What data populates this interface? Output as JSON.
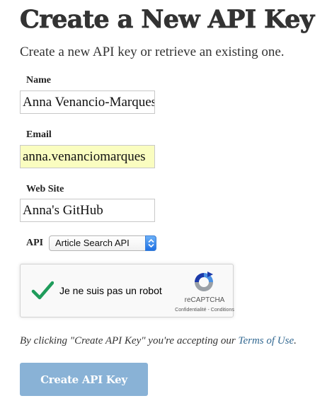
{
  "page": {
    "title": "Create a New API Key",
    "subtitle": "Create a new API key or retrieve an existing one."
  },
  "form": {
    "name": {
      "label": "Name",
      "value": "Anna Venancio-Marques"
    },
    "email": {
      "label": "Email",
      "value": "anna.venanciomarques"
    },
    "website": {
      "label": "Web Site",
      "value": "Anna's GitHub"
    },
    "api": {
      "label": "API",
      "selected": "Article Search API"
    }
  },
  "captcha": {
    "label": "Je ne suis pas un robot",
    "checked": true,
    "brand": "reCAPTCHA",
    "privacy": "Confidentialité",
    "separator": " - ",
    "terms": "Conditions",
    "check_color": "#1f9c5b"
  },
  "terms": {
    "prefix": "By clicking \"Create API Key\" you're accepting our ",
    "link_text": "Terms of Use",
    "suffix": "."
  },
  "submit": {
    "label": "Create API Key"
  },
  "colors": {
    "link": "#326891",
    "button_bg": "#89b2d6",
    "autofill_bg": "#fafdc0",
    "select_accent": "#1e70e3"
  }
}
